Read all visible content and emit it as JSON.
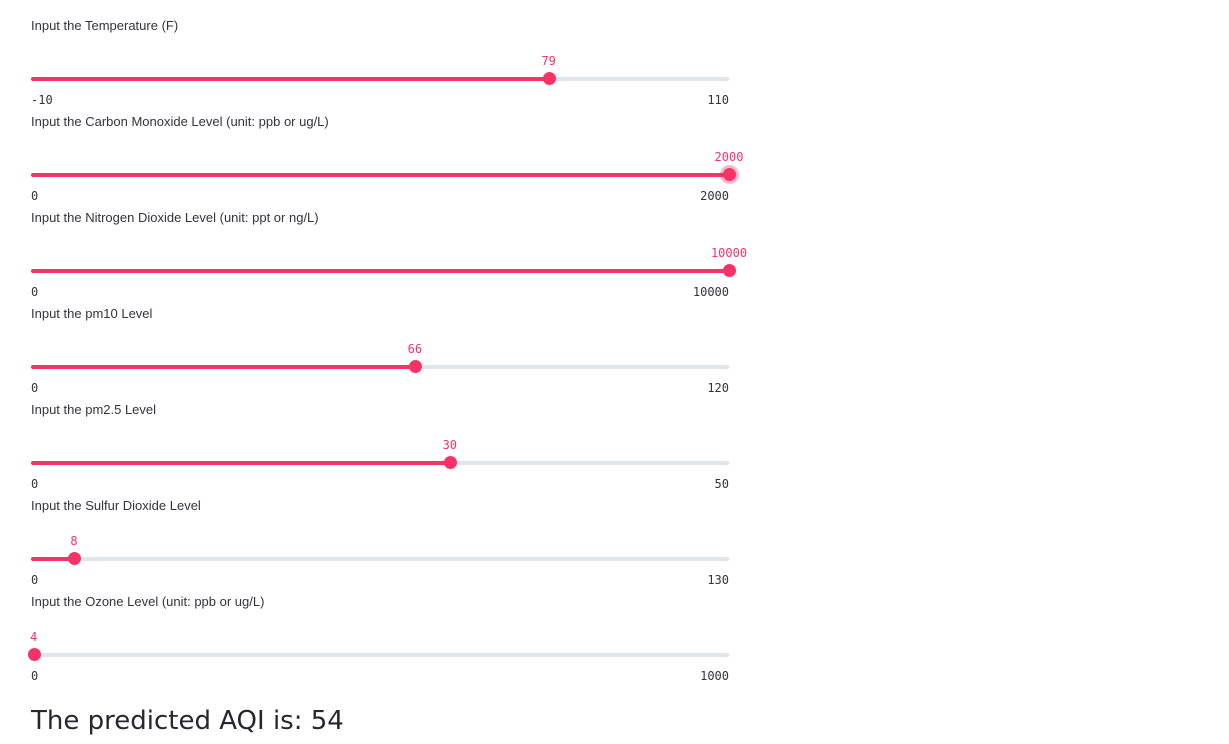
{
  "accent_color": "#f63366",
  "track_color": "#e0e4ec",
  "sliders": [
    {
      "label": "Input the Temperature (F)",
      "min": "-10",
      "max": "110",
      "value": "79",
      "min_num": -10,
      "max_num": 110,
      "value_num": 79,
      "focused": false
    },
    {
      "label": "Input the Carbon Monoxide Level (unit: ppb or ug/L)",
      "min": "0",
      "max": "2000",
      "value": "2000",
      "min_num": 0,
      "max_num": 2000,
      "value_num": 2000,
      "focused": true
    },
    {
      "label": "Input the Nitrogen Dioxide Level (unit: ppt or ng/L)",
      "min": "0",
      "max": "10000",
      "value": "10000",
      "min_num": 0,
      "max_num": 10000,
      "value_num": 10000,
      "focused": false
    },
    {
      "label": "Input the pm10 Level",
      "min": "0",
      "max": "120",
      "value": "66",
      "min_num": 0,
      "max_num": 120,
      "value_num": 66,
      "focused": false
    },
    {
      "label": "Input the pm2.5 Level",
      "min": "0",
      "max": "50",
      "value": "30",
      "min_num": 0,
      "max_num": 50,
      "value_num": 30,
      "focused": false
    },
    {
      "label": "Input the Sulfur Dioxide Level",
      "min": "0",
      "max": "130",
      "value": "8",
      "min_num": 0,
      "max_num": 130,
      "value_num": 8,
      "focused": false
    },
    {
      "label": "Input the Ozone Level (unit: ppb or ug/L)",
      "min": "0",
      "max": "1000",
      "value": "4",
      "min_num": 0,
      "max_num": 1000,
      "value_num": 4,
      "focused": false
    }
  ],
  "result": {
    "text": "The predicted AQI is: 54"
  }
}
